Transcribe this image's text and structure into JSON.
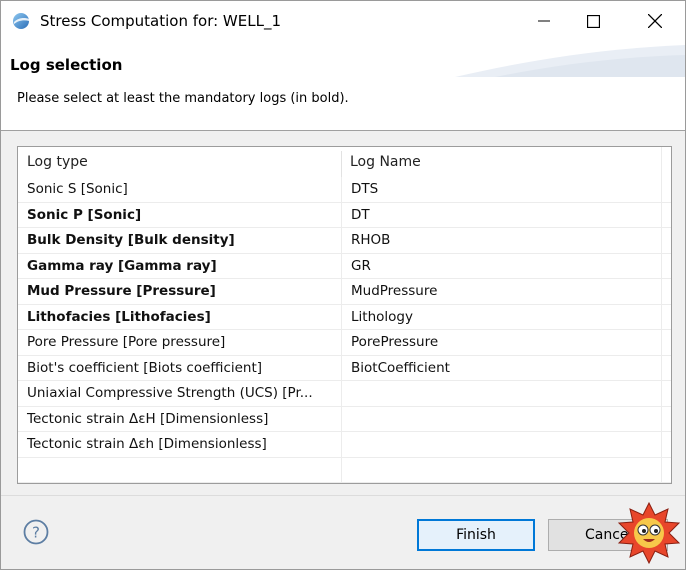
{
  "window": {
    "title": "Stress Computation for: WELL_1"
  },
  "header": {
    "title": "Log selection",
    "message": "Please select at least the mandatory logs (in bold)."
  },
  "table": {
    "columns": [
      "Log type",
      "Log Name"
    ],
    "rows": [
      {
        "type": "Sonic S [Sonic]",
        "name": "DTS",
        "bold": false
      },
      {
        "type": "Sonic P [Sonic]",
        "name": "DT",
        "bold": true
      },
      {
        "type": "Bulk Density [Bulk density]",
        "name": "RHOB",
        "bold": true
      },
      {
        "type": "Gamma ray [Gamma ray]",
        "name": "GR",
        "bold": true
      },
      {
        "type": "Mud Pressure [Pressure]",
        "name": "MudPressure",
        "bold": true
      },
      {
        "type": "Lithofacies [Lithofacies]",
        "name": "Lithology",
        "bold": true
      },
      {
        "type": "Pore Pressure [Pore pressure]",
        "name": "PorePressure",
        "bold": false
      },
      {
        "type": "Biot's coefficient [Biots coefficient]",
        "name": "BiotCoefficient",
        "bold": false
      },
      {
        "type": "Uniaxial Compressive Strength (UCS) [Pr...",
        "name": "",
        "bold": false
      },
      {
        "type": "Tectonic strain ΔεH [Dimensionless]",
        "name": "",
        "bold": false
      },
      {
        "type": "Tectonic strain Δεh [Dimensionless]",
        "name": "",
        "bold": false
      },
      {
        "type": "",
        "name": "",
        "bold": false
      }
    ]
  },
  "footer": {
    "finish_label": "Finish",
    "cancel_label": "Cancel",
    "help_glyph": "?"
  },
  "icons": {
    "app": "eclipse-app-icon",
    "minimize": "minimize-icon",
    "maximize": "maximize-icon",
    "close": "close-icon",
    "help": "help-icon",
    "mascot": "sun-mascot-icon"
  },
  "colors": {
    "accent": "#0078d7",
    "help_blue": "#5d7ea3",
    "header_bg": "#ffffff",
    "dialog_bg": "#f0f0f0"
  }
}
